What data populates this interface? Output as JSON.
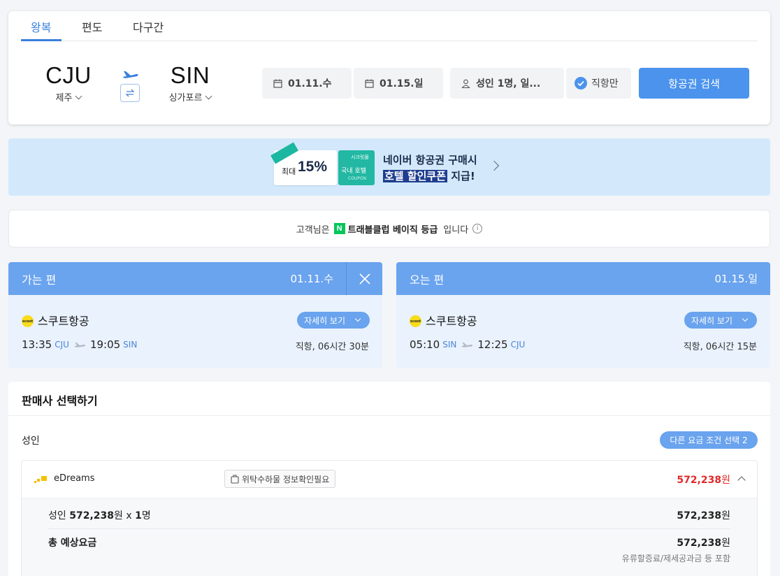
{
  "tabs": [
    {
      "label": "왕복",
      "active": true
    },
    {
      "label": "편도",
      "active": false
    },
    {
      "label": "다구간",
      "active": false
    }
  ],
  "origin": {
    "code": "CJU",
    "city": "제주"
  },
  "destination": {
    "code": "SIN",
    "city": "싱가포르"
  },
  "departure_date": "01.11.수",
  "return_date": "01.15.일",
  "passengers": "성인 1명, 일...",
  "direct_only": "직항만",
  "search_button": "항공권 검색",
  "banner": {
    "badge": "최대",
    "percent": "15%",
    "coupon_top": "시크릿몰",
    "coupon_mid": "국내 호텔",
    "coupon_bottom": "COUPON",
    "line1": "네이버 항공권 구매시",
    "line2_highlight": "호텔 할인쿠폰",
    "line2_rest": " 지급!"
  },
  "notice": {
    "prefix": "고객님은",
    "brand_letter": "N",
    "grade": "트래블클럽 베이직 등급",
    "suffix": "입니다"
  },
  "outbound": {
    "title": "가는 편",
    "date": "01.11.수",
    "airline": "스쿠트항공",
    "logo_text": "scoot",
    "detail_button": "자세히 보기",
    "dep_time": "13:35",
    "dep_airport": "CJU",
    "arr_time": "19:05",
    "arr_airport": "SIN",
    "duration": "직항, 06시간 30분"
  },
  "inbound": {
    "title": "오는 편",
    "date": "01.15.일",
    "airline": "스쿠트항공",
    "logo_text": "scoot",
    "detail_button": "자세히 보기",
    "dep_time": "05:10",
    "dep_airport": "SIN",
    "arr_time": "12:25",
    "arr_airport": "CJU",
    "duration": "직항, 06시간 15분"
  },
  "seller": {
    "title": "판매사 선택하기",
    "adult_label": "성인",
    "fare_option_button": "다른 요금 조건 선택 2",
    "vendor_name": "eDreams",
    "baggage": "위탁수하물 정보확인필요",
    "price": "572,238",
    "won": "원",
    "adult_row_label": "성인",
    "adult_row_price": "572,238",
    "adult_row_multiplier": "원 x ",
    "adult_row_count": "1",
    "adult_row_unit": "명",
    "adult_row_total": "572,238",
    "total_label": "총 예상요금",
    "total_price": "572,238",
    "total_note": "유류할증료/제세공과금 등 포함"
  },
  "colors": {
    "accent": "#4b93ec",
    "header_blue": "#6aa3ee",
    "price_red": "#e02b2b",
    "naver_green": "#03c75a"
  }
}
